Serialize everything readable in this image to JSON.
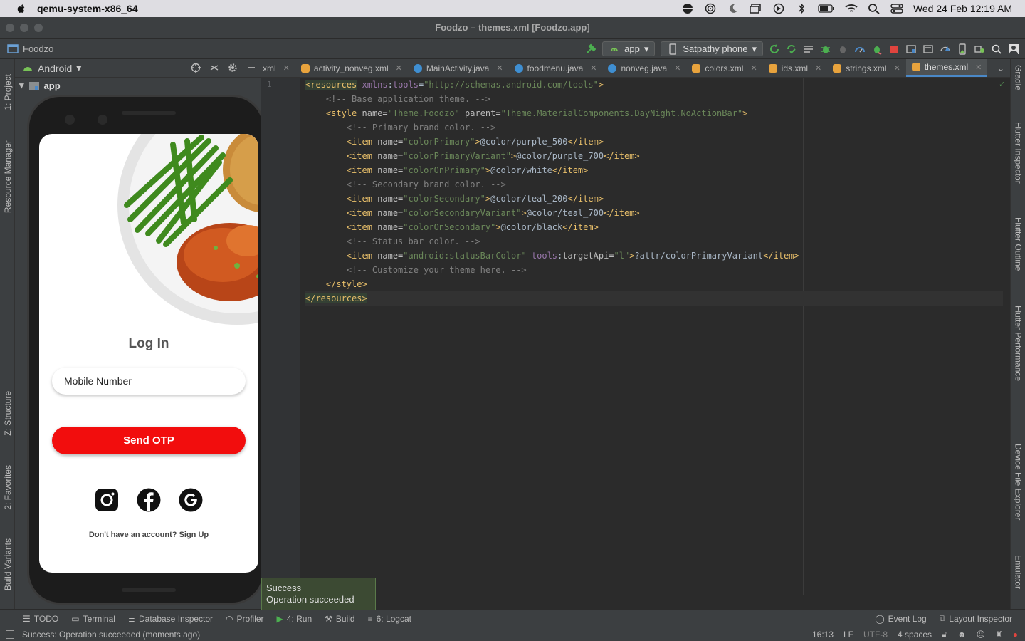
{
  "menubar": {
    "app_name": "qemu-system-x86_64",
    "datetime": "Wed 24 Feb  12:19 AM"
  },
  "window": {
    "title": "Foodzo – themes.xml [Foodzo.app]"
  },
  "toolbar": {
    "project_name": "Foodzo",
    "run_config": "app",
    "device": "Satpathy phone"
  },
  "project_panel": {
    "view_mode": "Android",
    "root": "app"
  },
  "left_tabs": [
    "1: Project",
    "Resource Manager",
    "Z: Structure",
    "2: Favorites",
    "Build Variants"
  ],
  "right_tabs": [
    "Gradle",
    "Flutter Inspector",
    "Flutter Outline",
    "Flutter Performance",
    "Device File Explorer",
    "Emulator"
  ],
  "tabs": [
    "xml",
    "activity_nonveg.xml",
    "MainActivity.java",
    "foodmenu.java",
    "nonveg.java",
    "colors.xml",
    "ids.xml",
    "strings.xml",
    "themes.xml"
  ],
  "active_tab": "themes.xml",
  "editor": {
    "line_number": "1"
  },
  "phone": {
    "login_title": "Log In",
    "mobile_placeholder": "Mobile Number",
    "otp_button": "Send OTP",
    "signup_text": "Don't have an account? Sign Up",
    "social": [
      "instagram",
      "facebook",
      "google"
    ]
  },
  "toast": {
    "title": "Success",
    "message": "Operation succeeded"
  },
  "bottom_tools": {
    "todo": "TODO",
    "terminal": "Terminal",
    "db": "Database Inspector",
    "profiler": "Profiler",
    "run": "4: Run",
    "build": "Build",
    "logcat": "6: Logcat",
    "event_log": "Event Log",
    "layout_inspector": "Layout Inspector"
  },
  "status": {
    "message": "Success: Operation succeeded (moments ago)",
    "position": "16:13",
    "line_sep": "LF",
    "encoding": "UTF-8",
    "indent": "4 spaces"
  },
  "colors": {
    "accent_red": "#f20d0d",
    "tab_underline": "#4a88c7",
    "tag": "#e8bf6a",
    "string": "#6a8759",
    "comment": "#808080"
  }
}
